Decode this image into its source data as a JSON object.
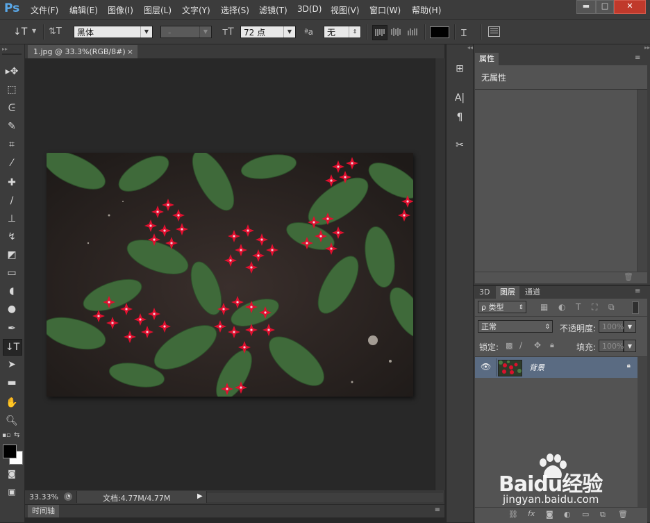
{
  "app": {
    "logo": "Ps"
  },
  "menu": [
    "文件(F)",
    "编辑(E)",
    "图像(I)",
    "图层(L)",
    "文字(Y)",
    "选择(S)",
    "滤镜(T)",
    "3D(D)",
    "视图(V)",
    "窗口(W)",
    "帮助(H)"
  ],
  "window_controls": {
    "minimize": "▬",
    "maximize": "□",
    "close": "✕"
  },
  "options": {
    "tool_glyph": "↓T",
    "font_family": "黑体",
    "font_style": "-",
    "font_size": "72 点",
    "aa_glyph": "ªa",
    "antialias": "无"
  },
  "document": {
    "tab_title": "1.jpg @ 33.3%(RGB/8#)",
    "tab_close": "×",
    "zoom": "33.33%",
    "doc_info": "文档:4.77M/4.77M"
  },
  "timeline": {
    "label": "时间轴"
  },
  "properties": {
    "tab": "属性",
    "empty_text": "无属性"
  },
  "layers_panel": {
    "tabs": [
      "3D",
      "图层",
      "通道"
    ],
    "filter_type": "ρ 类型",
    "blend_mode": "正常",
    "opacity_label": "不透明度:",
    "opacity_value": "100%",
    "lock_label": "锁定:",
    "fill_label": "填充:",
    "fill_value": "100%",
    "layer_name": "背景"
  },
  "watermark": {
    "brand": "Baidu经验",
    "url": "jingyan.baidu.com"
  },
  "colors": {
    "accent": "#5aa8e8",
    "panel": "#3c3c3c",
    "selected_layer": "#5a6b82"
  }
}
